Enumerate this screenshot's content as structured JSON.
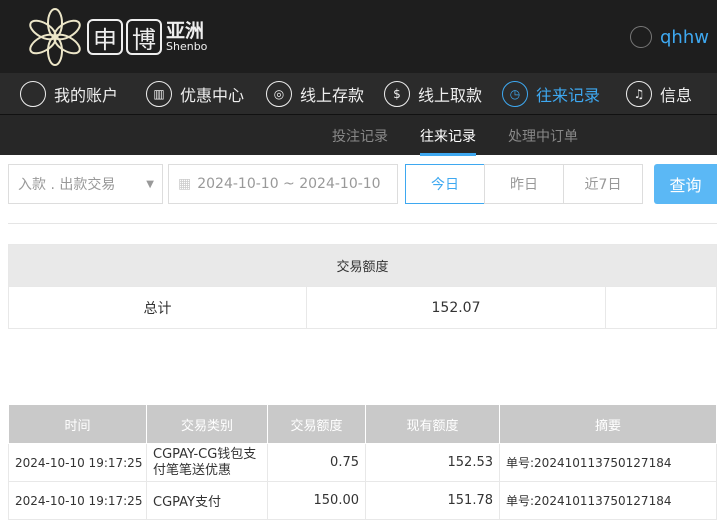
{
  "header": {
    "logo_chars": [
      "申",
      "博"
    ],
    "logo_cn": "亚洲",
    "logo_en": "Shenbo",
    "username": "qhhw"
  },
  "nav": {
    "items": [
      {
        "label": "我的账户",
        "icon": "user-icon"
      },
      {
        "label": "优惠中心",
        "icon": "gift-icon"
      },
      {
        "label": "线上存款",
        "icon": "deposit-icon"
      },
      {
        "label": "线上取款",
        "icon": "withdraw-icon"
      },
      {
        "label": "往来记录",
        "icon": "records-icon",
        "active": true
      },
      {
        "label": "信息",
        "icon": "bell-icon"
      }
    ]
  },
  "subnav": {
    "items": [
      "投注记录",
      "往来记录",
      "处理中订单"
    ],
    "active": "往来记录"
  },
  "filters": {
    "type_select": "入款 . 出款交易",
    "date_range": "2024-10-10 ~ 2024-10-10",
    "quick": [
      "今日",
      "昨日",
      "近7日"
    ],
    "search": "查询"
  },
  "summary": {
    "header": "交易额度",
    "label": "总计",
    "value": "152.07"
  },
  "records": {
    "columns": [
      "时间",
      "交易类别",
      "交易额度",
      "现有额度",
      "摘要"
    ],
    "rows": [
      {
        "time": "2024-10-10 19:17:25",
        "type": "CGPAY-CG钱包支付笔笔送优惠",
        "amount": "0.75",
        "balance": "152.53",
        "summary": "单号:202410113750127184"
      },
      {
        "time": "2024-10-10 19:17:25",
        "type": "CGPAY支付",
        "amount": "150.00",
        "balance": "151.78",
        "summary": "单号:202410113750127184"
      }
    ]
  },
  "colors": {
    "accent": "#3ea8f0",
    "search_button": "#5bb8f5",
    "header_bg": "#1e1e1e"
  }
}
